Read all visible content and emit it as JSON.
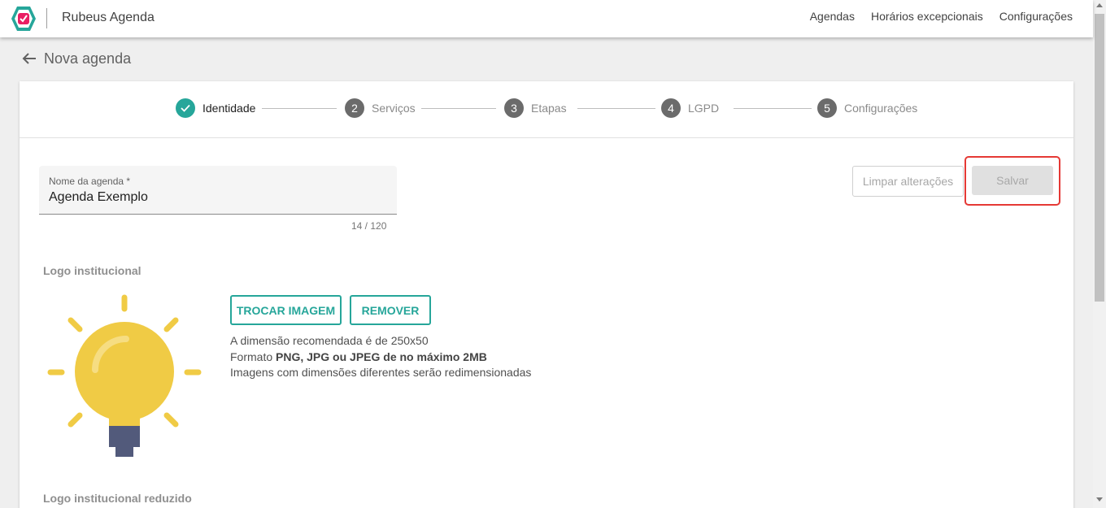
{
  "app": {
    "title": "Rubeus Agenda",
    "logo_icon": "rubeus-logo-icon"
  },
  "nav": {
    "items": [
      "Agendas",
      "Horários excepcionais",
      "Configurações"
    ]
  },
  "page": {
    "title": "Nova agenda"
  },
  "stepper": {
    "steps": [
      {
        "label": "Identidade",
        "number": "✓",
        "state": "done"
      },
      {
        "label": "Serviços",
        "number": "2",
        "state": "pending"
      },
      {
        "label": "Etapas",
        "number": "3",
        "state": "pending"
      },
      {
        "label": "LGPD",
        "number": "4",
        "state": "pending"
      },
      {
        "label": "Configurações",
        "number": "5",
        "state": "pending"
      }
    ]
  },
  "form": {
    "name_label": "Nome da agenda *",
    "name_value": "Agenda Exemplo",
    "counter": "14 / 120"
  },
  "actions": {
    "clear_label": "Limpar alterações",
    "save_label": "Salvar"
  },
  "logo_section": {
    "label": "Logo institucional",
    "change_button": "TROCAR IMAGEM",
    "remove_button": "REMOVER",
    "hint_dimension": "A dimensão recomendada é de 250x50",
    "hint_format_prefix": "Formato ",
    "hint_format_bold": "PNG, JPG ou JPEG de no máximo 2MB",
    "hint_resize": "Imagens com dimensões diferentes serão redimensionadas"
  },
  "logo_reduced_section": {
    "label": "Logo institucional reduzido"
  },
  "colors": {
    "accent": "#26a69a",
    "highlight": "#e53935",
    "bulb_yellow": "#f0cb45",
    "bulb_base": "#525a7b"
  }
}
